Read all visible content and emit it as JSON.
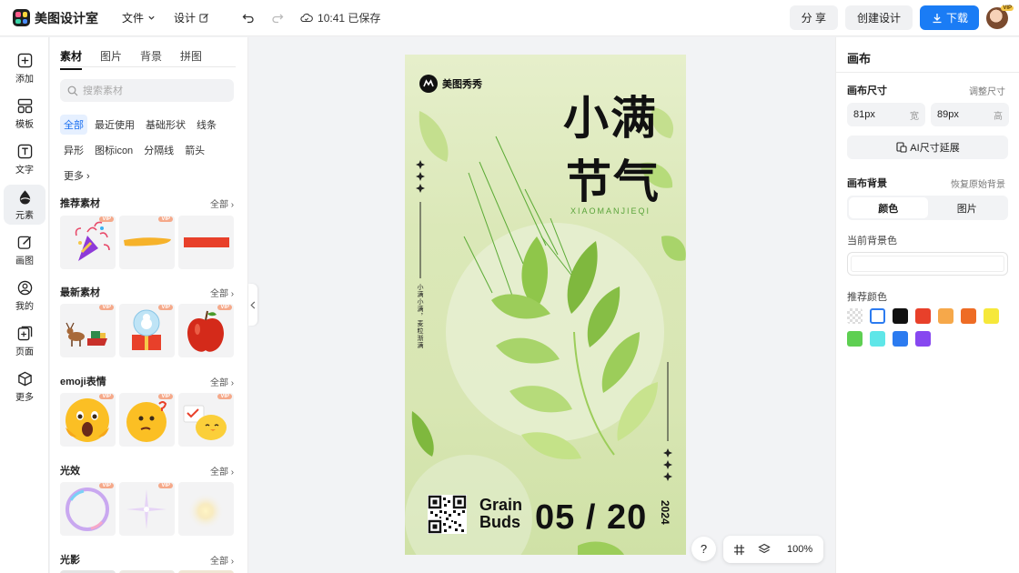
{
  "app": {
    "name": "美图设计室"
  },
  "menu": {
    "file": "文件",
    "design": "设计"
  },
  "save_status": "10:41 已保存",
  "top_right": {
    "share": "分 享",
    "create": "创建设计",
    "download": "下载",
    "avatar_badge": "VIP"
  },
  "leftnav": [
    {
      "label": "添加",
      "icon": "plus-square-icon"
    },
    {
      "label": "模板",
      "icon": "template-icon"
    },
    {
      "label": "文字",
      "icon": "text-icon"
    },
    {
      "label": "元素",
      "icon": "shapes-icon"
    },
    {
      "label": "画图",
      "icon": "pencil-icon"
    },
    {
      "label": "我的",
      "icon": "user-icon"
    },
    {
      "label": "页面",
      "icon": "page-add-icon"
    },
    {
      "label": "更多",
      "icon": "cube-icon"
    }
  ],
  "leftnav_active": "元素",
  "assets": {
    "tabs": [
      "素材",
      "图片",
      "背景",
      "拼图"
    ],
    "search_placeholder": "搜索素材",
    "chips": [
      "全部",
      "最近使用",
      "基础形状",
      "线条",
      "异形",
      "图标icon",
      "分隔线",
      "箭头",
      "更多"
    ],
    "all_label": "全部",
    "vip": "VIP",
    "sections": [
      {
        "title": "推荐素材",
        "thumbs": [
          "party-popper",
          "yellow-brush-stroke",
          "red-rectangle"
        ]
      },
      {
        "title": "最新素材",
        "thumbs": [
          "reindeer-sleigh",
          "christmas-snow-globe",
          "red-apple"
        ]
      },
      {
        "title": "emoji表情",
        "thumbs": [
          "shocked-emoji",
          "thinking-emoji",
          "chick-emoji"
        ]
      },
      {
        "title": "光效",
        "thumbs": [
          "bubble-ring",
          "sparkle-light",
          "soft-glow"
        ]
      },
      {
        "title": "光影",
        "thumbs": []
      }
    ]
  },
  "poster": {
    "brand": "美图秀秀",
    "title_line1": "小满",
    "title_line2": "节气",
    "pinyin": "XIAOMANJIEQI",
    "vertical_text": "小满小满，麦粒渐满",
    "grain": "Grain",
    "buds": "Buds",
    "date": "05 / 20",
    "year": "2024",
    "colors": {
      "leaf_dark": "#7fb83e",
      "leaf_light": "#c8e38e",
      "bg": "#dbe8b8"
    }
  },
  "canvas_tools": {
    "help": "?",
    "zoom": "100%"
  },
  "right_panel": {
    "title": "画布",
    "size_label": "画布尺寸",
    "resize_link": "调整尺寸",
    "width_value": "81px",
    "width_unit": "宽",
    "height_value": "89px",
    "height_unit": "高",
    "ai_extend": "AI尺寸延展",
    "bg_label": "画布背景",
    "restore_link": "恢复原始背景",
    "seg_color": "颜色",
    "seg_image": "图片",
    "current_bg_label": "当前背景色",
    "recommended_label": "推荐颜色",
    "swatches": [
      "transparent",
      "#ffffff",
      "#111111",
      "#e8402a",
      "#f6a84a",
      "#ee6c25",
      "#f6e83a",
      "#5ecf52",
      "#5fe6e8",
      "#2c7bf0",
      "#8748f0"
    ]
  }
}
